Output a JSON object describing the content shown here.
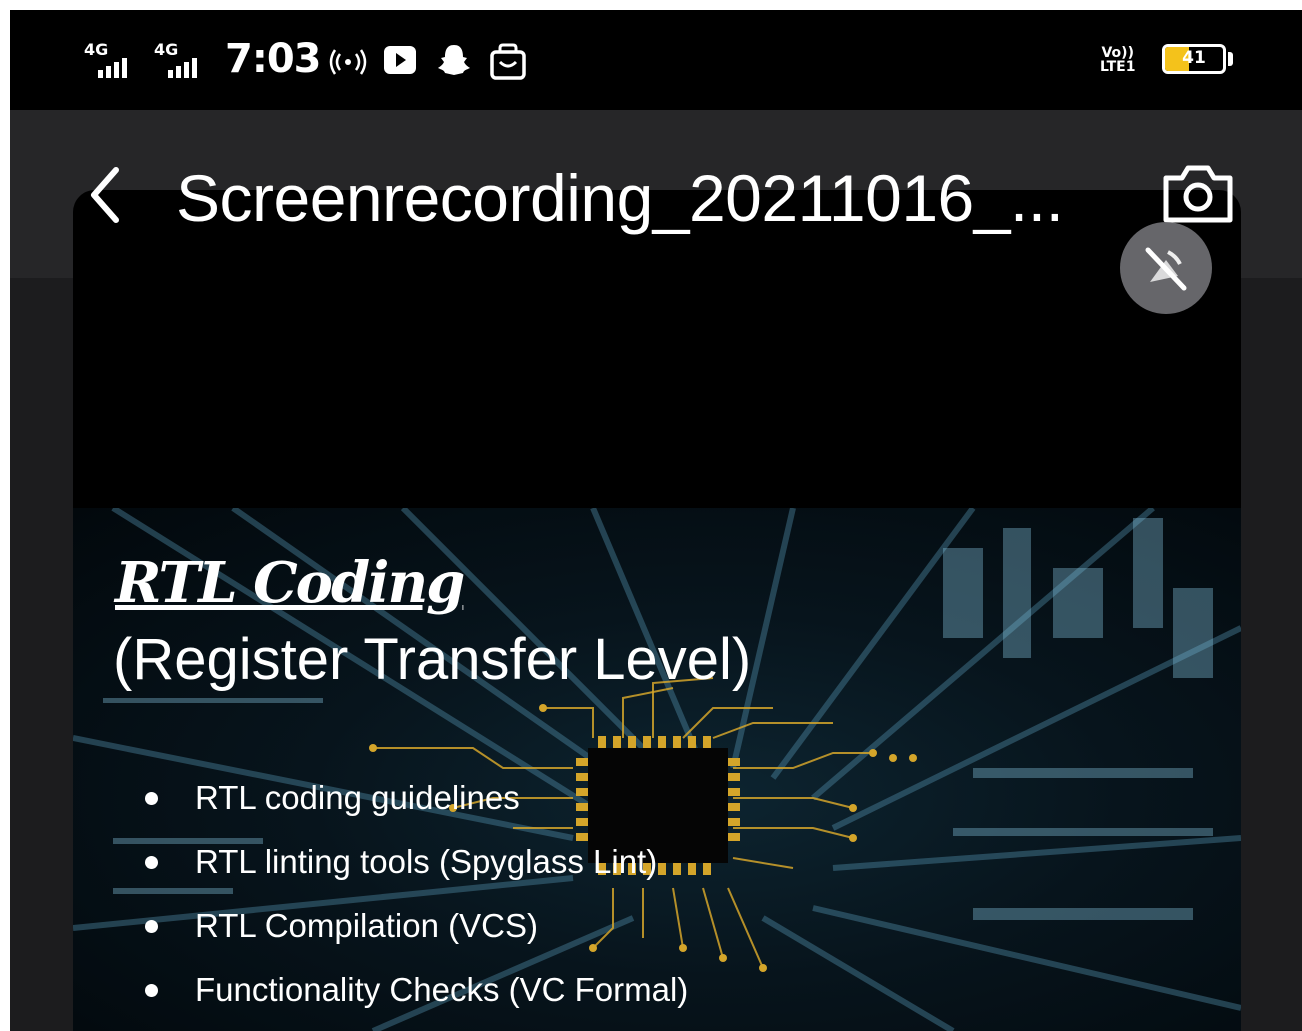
{
  "status_bar": {
    "signal_1": "4G",
    "signal_2": "4G",
    "time": "7:03",
    "icons": [
      "hotspot-icon",
      "youtube-icon",
      "snapchat-icon",
      "bag-icon"
    ],
    "volte_top": "Vo))",
    "volte_bottom": "LTE1",
    "battery_level": "41",
    "battery_fraction": 0.41,
    "battery_color": "#f4c21b"
  },
  "app_bar": {
    "title": "Screenrecording_20211016_...",
    "back_icon": "chevron-left-icon",
    "camera_icon": "camera-icon",
    "mute_icon": "mute-icon"
  },
  "slide": {
    "title": "RTL Coding",
    "subtitle": "(Register Transfer Level)",
    "bullets": [
      "RTL coding guidelines",
      "RTL linting tools (Spyglass Lint)",
      "RTL Compilation (VCS)",
      "Functionality Checks (VC Formal)"
    ],
    "background_icon": "circuit-chip-icon",
    "accent": "#d4a52a"
  }
}
